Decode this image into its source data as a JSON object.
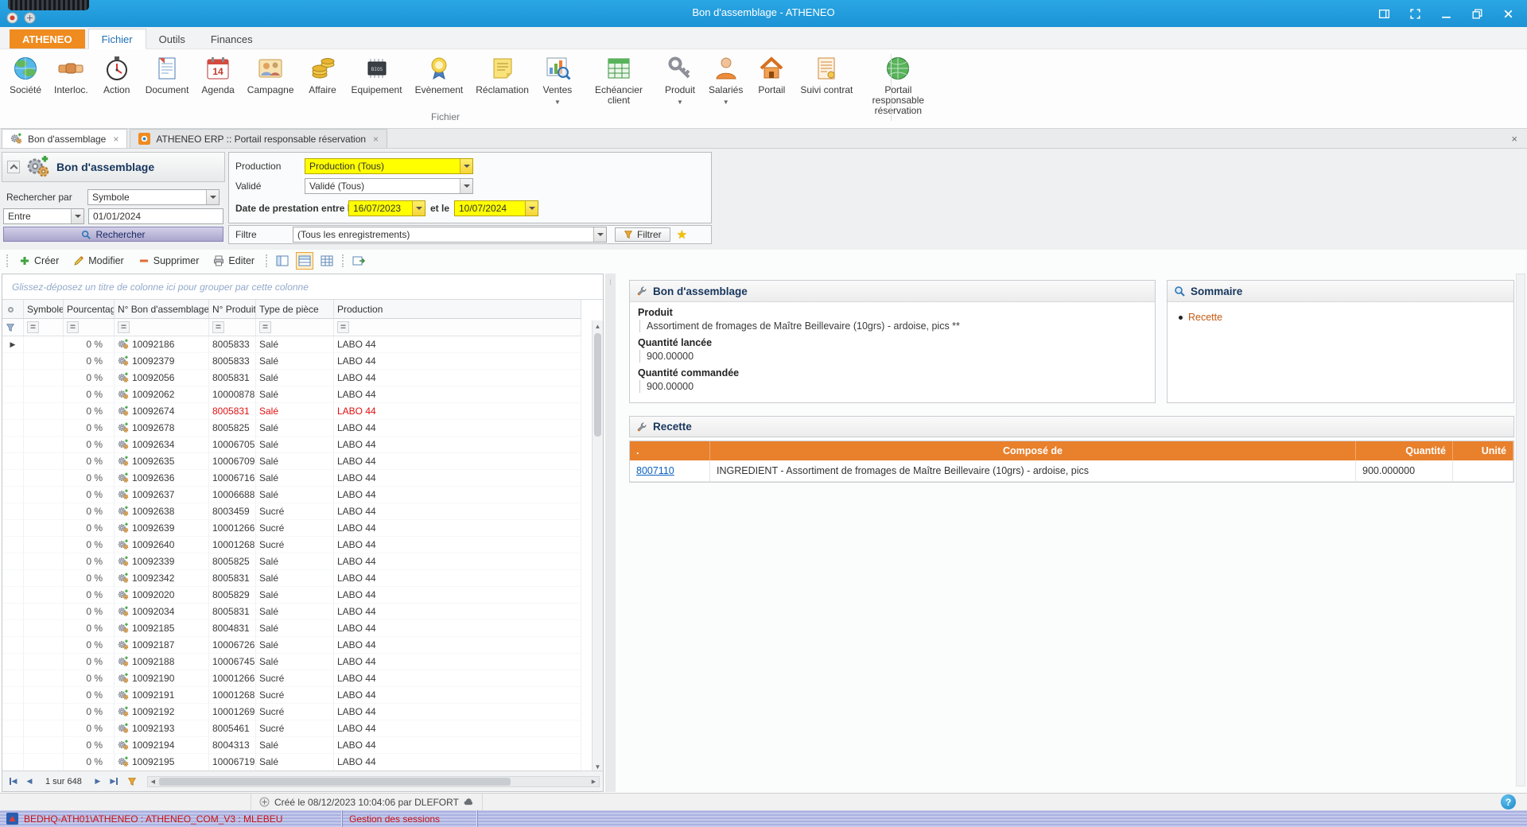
{
  "window": {
    "title": "Bon d'assemblage - ATHENEO"
  },
  "ribbon": {
    "tabs": [
      {
        "label": "ATHENEO",
        "style": "brand"
      },
      {
        "label": "Fichier",
        "style": "active"
      },
      {
        "label": "Outils",
        "style": ""
      },
      {
        "label": "Finances",
        "style": ""
      }
    ],
    "group_label": "Fichier",
    "items": [
      {
        "label": "Société",
        "icon": "globe-blue-icon"
      },
      {
        "label": "Interloc.",
        "icon": "handshake-icon"
      },
      {
        "label": "Action",
        "icon": "clock-icon"
      },
      {
        "label": "Document",
        "icon": "document-icon"
      },
      {
        "label": "Agenda",
        "icon": "calendar-icon"
      },
      {
        "label": "Campagne",
        "icon": "campaign-icon"
      },
      {
        "label": "Affaire",
        "icon": "coins-icon"
      },
      {
        "label": "Equipement",
        "icon": "chip-icon"
      },
      {
        "label": "Evènement",
        "icon": "event-icon"
      },
      {
        "label": "Réclamation",
        "icon": "note-icon"
      },
      {
        "label": "Ventes",
        "icon": "sales-chart-icon",
        "dropdown": true
      },
      {
        "label": "Echéancier client",
        "icon": "schedule-icon"
      },
      {
        "label": "Produit",
        "icon": "key-icon",
        "dropdown": true
      },
      {
        "label": "Salariés",
        "icon": "person-icon",
        "dropdown": true
      },
      {
        "label": "Portail",
        "icon": "home-icon"
      },
      {
        "label": "Suivi contrat",
        "icon": "contract-icon"
      },
      {
        "label": "Portail responsable réservation",
        "icon": "globe-green-icon"
      }
    ]
  },
  "doc_tabs": [
    {
      "label": "ATHENEO ERP :: Portail responsable réservation",
      "icon": "atheneo-icon",
      "active": false
    },
    {
      "label": "Bon d'assemblage",
      "icon": "assembly-icon",
      "active": true
    }
  ],
  "search_panel": {
    "title": "Bon d'assemblage",
    "rechercher_par_label": "Rechercher par",
    "rechercher_par_value": "Symbole",
    "entre_value": "Entre",
    "date_value": "01/01/2024",
    "search_button": "Rechercher"
  },
  "filter_panel": {
    "production_label": "Production",
    "production_value": "Production (Tous)",
    "valide_label": "Validé",
    "valide_value": "Validé (Tous)",
    "date_label": "Date de prestation entre le",
    "date_from": "16/07/2023",
    "et_le_label": "et le",
    "date_to": "10/07/2024",
    "filtre_label": "Filtre",
    "filtre_value": "(Tous les enregistrements)",
    "filtrer_button": "Filtrer"
  },
  "toolbar": {
    "creer": "Créer",
    "modifier": "Modifier",
    "supprimer": "Supprimer",
    "editer": "Editer"
  },
  "grid": {
    "group_hint": "Glissez-déposez un titre de colonne ici pour grouper par cette colonne",
    "columns": [
      "",
      "Symbole",
      "Pourcentage",
      "N° Bon d'assemblage",
      "N° Produit",
      "Type de pièce",
      "Production"
    ],
    "pager": "1 sur 648",
    "rows": [
      {
        "pourcentage": "0 %",
        "bon": "10092186",
        "produit": "8005833",
        "type": "Salé",
        "production": "LABO 44",
        "current": true
      },
      {
        "pourcentage": "0 %",
        "bon": "10092379",
        "produit": "8005833",
        "type": "Salé",
        "production": "LABO 44"
      },
      {
        "pourcentage": "0 %",
        "bon": "10092056",
        "produit": "8005831",
        "type": "Salé",
        "production": "LABO 44"
      },
      {
        "pourcentage": "0 %",
        "bon": "10092062",
        "produit": "10000878",
        "type": "Salé",
        "production": "LABO 44"
      },
      {
        "pourcentage": "0 %",
        "bon": "10092674",
        "produit": "8005831",
        "type": "Salé",
        "production": "LABO 44",
        "red": true
      },
      {
        "pourcentage": "0 %",
        "bon": "10092678",
        "produit": "8005825",
        "type": "Salé",
        "production": "LABO 44"
      },
      {
        "pourcentage": "0 %",
        "bon": "10092634",
        "produit": "10006705",
        "type": "Salé",
        "production": "LABO 44"
      },
      {
        "pourcentage": "0 %",
        "bon": "10092635",
        "produit": "10006709",
        "type": "Salé",
        "production": "LABO 44"
      },
      {
        "pourcentage": "0 %",
        "bon": "10092636",
        "produit": "10006716",
        "type": "Salé",
        "production": "LABO 44"
      },
      {
        "pourcentage": "0 %",
        "bon": "10092637",
        "produit": "10006688",
        "type": "Salé",
        "production": "LABO 44"
      },
      {
        "pourcentage": "0 %",
        "bon": "10092638",
        "produit": "8003459",
        "type": "Sucré",
        "production": "LABO 44"
      },
      {
        "pourcentage": "0 %",
        "bon": "10092639",
        "produit": "10001266",
        "type": "Sucré",
        "production": "LABO 44"
      },
      {
        "pourcentage": "0 %",
        "bon": "10092640",
        "produit": "10001268",
        "type": "Sucré",
        "production": "LABO 44"
      },
      {
        "pourcentage": "0 %",
        "bon": "10092339",
        "produit": "8005825",
        "type": "Salé",
        "production": "LABO 44"
      },
      {
        "pourcentage": "0 %",
        "bon": "10092342",
        "produit": "8005831",
        "type": "Salé",
        "production": "LABO 44"
      },
      {
        "pourcentage": "0 %",
        "bon": "10092020",
        "produit": "8005829",
        "type": "Salé",
        "production": "LABO 44"
      },
      {
        "pourcentage": "0 %",
        "bon": "10092034",
        "produit": "8005831",
        "type": "Salé",
        "production": "LABO 44"
      },
      {
        "pourcentage": "0 %",
        "bon": "10092185",
        "produit": "8004831",
        "type": "Salé",
        "production": "LABO 44"
      },
      {
        "pourcentage": "0 %",
        "bon": "10092187",
        "produit": "10006726",
        "type": "Salé",
        "production": "LABO 44"
      },
      {
        "pourcentage": "0 %",
        "bon": "10092188",
        "produit": "10006745",
        "type": "Salé",
        "production": "LABO 44"
      },
      {
        "pourcentage": "0 %",
        "bon": "10092190",
        "produit": "10001266",
        "type": "Sucré",
        "production": "LABO 44"
      },
      {
        "pourcentage": "0 %",
        "bon": "10092191",
        "produit": "10001268",
        "type": "Sucré",
        "production": "LABO 44"
      },
      {
        "pourcentage": "0 %",
        "bon": "10092192",
        "produit": "10001269",
        "type": "Sucré",
        "production": "LABO 44"
      },
      {
        "pourcentage": "0 %",
        "bon": "10092193",
        "produit": "8005461",
        "type": "Sucré",
        "production": "LABO 44"
      },
      {
        "pourcentage": "0 %",
        "bon": "10092194",
        "produit": "8004313",
        "type": "Salé",
        "production": "LABO 44"
      },
      {
        "pourcentage": "0 %",
        "bon": "10092195",
        "produit": "10006719",
        "type": "Salé",
        "production": "LABO 44"
      }
    ]
  },
  "details": {
    "bon": {
      "title": "Bon d'assemblage",
      "fields": [
        {
          "label": "Produit",
          "value": "Assortiment de fromages de Maître Beillevaire (10grs) - ardoise, pics **"
        },
        {
          "label": "Quantité lancée",
          "value": "900.00000"
        },
        {
          "label": "Quantité commandée",
          "value": "900.00000"
        }
      ]
    },
    "sommaire": {
      "title": "Sommaire",
      "links": [
        "Recette"
      ]
    },
    "recette": {
      "title": "Recette",
      "columns": [
        ".",
        "Composé de",
        "Quantité",
        "Unité"
      ],
      "rows": [
        {
          "id": "8007110",
          "compose": "INGREDIENT - Assortiment de fromages de Maître Beillevaire (10grs) - ardoise, pics",
          "quantite": "900.000000",
          "unite": ""
        }
      ]
    }
  },
  "status_bar": {
    "created_text": "Créé le 08/12/2023 10:04:06 par DLEFORT"
  },
  "session_bar": {
    "connection": "BEDHQ-ATH01\\ATHENEO : ATHENEO_COM_V3 : MLEBEU",
    "sessions_label": "Gestion des sessions"
  }
}
